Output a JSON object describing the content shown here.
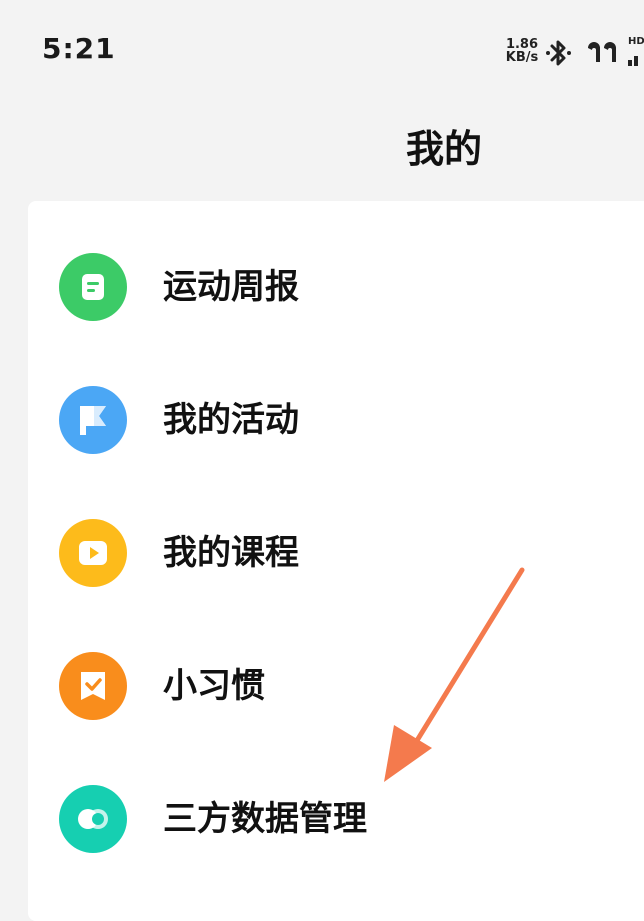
{
  "status_bar": {
    "time": "5:21",
    "net_speed_value": "1.86",
    "net_speed_unit": "KB/s",
    "network_label": "HD",
    "icons": [
      "bluetooth-icon",
      "earbuds-icon",
      "signal-icon"
    ]
  },
  "header": {
    "title": "我的"
  },
  "menu": {
    "items": [
      {
        "label": "运动周报",
        "icon": "weekly-report-icon",
        "color": "#3ccb67"
      },
      {
        "label": "我的活动",
        "icon": "flag-icon",
        "color": "#4ba7f5"
      },
      {
        "label": "我的课程",
        "icon": "play-icon",
        "color": "#fdbb1b"
      },
      {
        "label": "小习惯",
        "icon": "habit-check-icon",
        "color": "#f98d1c"
      },
      {
        "label": "三方数据管理",
        "icon": "third-party-data-icon",
        "color": "#16cfb1"
      }
    ]
  },
  "annotation": {
    "arrow_color": "#f47a4d"
  }
}
